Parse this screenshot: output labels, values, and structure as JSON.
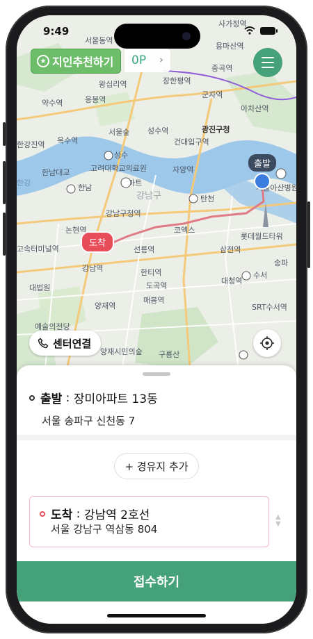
{
  "status_bar": {
    "time": "9:49"
  },
  "header": {
    "referral_label": "지인추천하기",
    "points_label": "0P",
    "points_chevron": "›",
    "menu_icon": "hamburger-icon"
  },
  "map": {
    "start_pin_label": "출발",
    "end_pin_label": "도착",
    "labels": {
      "l1": "사가정역",
      "l2": "서울동역",
      "l3": "용마산역",
      "l4": "왕십리역",
      "l5": "장한평역",
      "l6": "중곡역",
      "l7": "군자역",
      "l8": "약수역",
      "l9": "응봉역",
      "l10": "아차산역",
      "l11": "서울숲",
      "l12": "성수역",
      "l13": "광진구청",
      "l14": "건대입구역",
      "l15": "한강진역",
      "l16": "옥수역",
      "l17": "성수",
      "l18": "고려대학교의료원",
      "l19": "자양역",
      "l20": "한남대교",
      "l21": "한남",
      "l22": "탄천",
      "l23": "서울아산병원",
      "l24": "논현역",
      "l25": "강남구청역",
      "l26": "코엑스",
      "l27": "롯데월드타워",
      "l28": "고속터미널역",
      "l29": "선릉역",
      "l30": "삼전역",
      "l31": "강남역",
      "l32": "한티역",
      "l33": "도곡역",
      "l34": "대청역",
      "l35": "수서",
      "l36": "대법원",
      "l37": "양재역",
      "l38": "매봉역",
      "l39": "SRT수서역",
      "l40": "예술의전당",
      "l41": "구룡산",
      "l42": "강남구",
      "l43": "송파",
      "l44": "양재시민의숲",
      "l45": "한강",
      "l46": "이마트"
    }
  },
  "controls": {
    "center_connect_label": "센터연결",
    "phone_icon": "phone-icon",
    "locate_icon": "locate-icon"
  },
  "route": {
    "start_title": "출발",
    "start_place": "장미아파트 13동",
    "start_address": "서울 송파구 신천동 7",
    "add_waypoint_label": "+ 경유지 추가",
    "dest_title": "도착",
    "dest_place": "강남역 2호선",
    "dest_address": "서울 강남구 역삼동 804",
    "separator": " : "
  },
  "submit_label": "접수하기",
  "colors": {
    "accent": "#45a179",
    "referral": "#6dbd6a",
    "start_pin": "#3b7ee0",
    "end_pin": "#e84d5a",
    "route_line": "#e07b85"
  }
}
